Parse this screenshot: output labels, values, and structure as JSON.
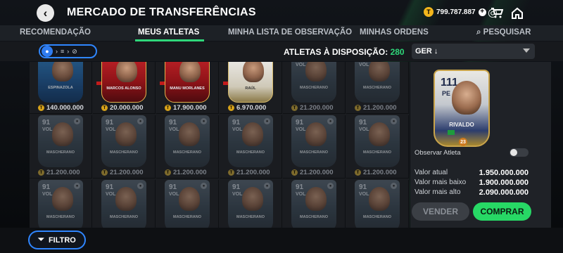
{
  "header": {
    "title": "MERCADO DE TRANSFERÊNCIAS",
    "coins": "799.787.887"
  },
  "tabs": [
    {
      "label": "RECOMENDAÇÃO"
    },
    {
      "label": "MEUS ATLETAS"
    },
    {
      "label": "MINHA LISTA DE OBSERVAÇÃO"
    },
    {
      "label": "MINHAS ORDENS"
    },
    {
      "label": "PESQUISAR"
    }
  ],
  "toolbar": {
    "available_label": "ATLETAS À DISPOSIÇÃO:",
    "available_count": "280",
    "sort_selected": "GER ↓"
  },
  "top_row": [
    {
      "rating": "",
      "pos": "",
      "name": "ESPINAZOLA",
      "price": "140.000.000",
      "style": "blue"
    },
    {
      "rating": "",
      "pos": "",
      "name": "MARCOS ALONSO",
      "price": "20.000.000",
      "style": "red"
    },
    {
      "rating": "",
      "pos": "",
      "name": "MANU MORLANES",
      "price": "17.900.000",
      "style": "red"
    },
    {
      "rating": "",
      "pos": "",
      "name": "RAÚL",
      "price": "6.970.000",
      "style": "white"
    },
    {
      "rating": "91",
      "pos": "VOL",
      "name": "MASCHERANO",
      "price": "21.200.000",
      "style": "gray"
    },
    {
      "rating": "91",
      "pos": "VOL",
      "name": "MASCHERANO",
      "price": "21.200.000",
      "style": "gray"
    }
  ],
  "grid_card": {
    "rating": "91",
    "pos": "VOL",
    "name": "MASCHERANO",
    "price": "21.200.000"
  },
  "detail": {
    "rating": "111",
    "pos": "PE",
    "name": "RIVALDO",
    "badge": "23",
    "watch_label": "Observar Atleta",
    "rows": [
      {
        "k": "Valor atual",
        "v": "1.950.000.000"
      },
      {
        "k": "Valor mais baixo",
        "v": "1.900.000.000"
      },
      {
        "k": "Valor mais alto",
        "v": "2.090.000.000"
      }
    ],
    "sell": "VENDER",
    "buy": "COMPRAR"
  },
  "footer": {
    "filter": "FILTRO"
  }
}
